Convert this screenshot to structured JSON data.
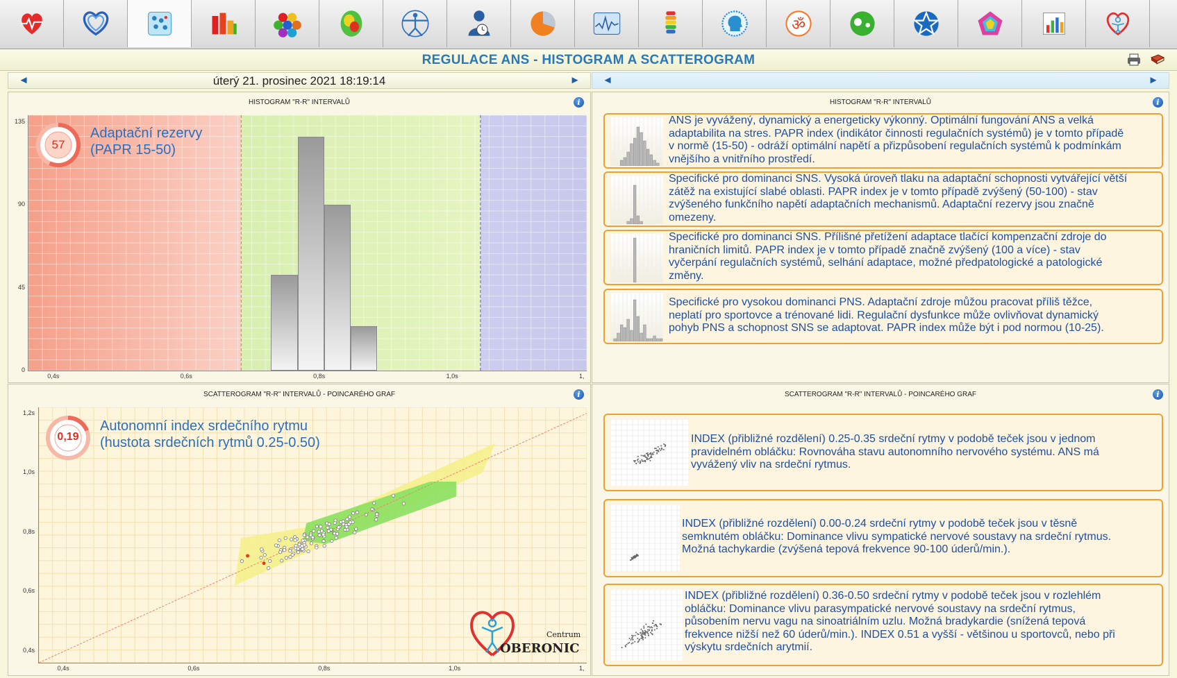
{
  "toolbar": {
    "icons": [
      "heart-pulse-icon",
      "double-heart-icon",
      "dot-grid-icon",
      "bar-chart-icon",
      "hexagon-cluster-icon",
      "brain-map-icon",
      "vitruvian-man-icon",
      "user-clock-icon",
      "pie-chart-icon",
      "waveform-monitor-icon",
      "spine-icon",
      "head-profile-icon",
      "om-symbol-icon",
      "yin-yang-icon",
      "star-icon",
      "radar-pentagon-icon",
      "mini-bar-chart-icon",
      "oberonic-logo-icon"
    ],
    "active_index": 2
  },
  "header": {
    "title": "REGULACE ANS - HISTOGRAM A SCATTEROGRAM"
  },
  "datebar": {
    "date": "úterý 21. prosinec 2021 18:19:14"
  },
  "histogram": {
    "title": "HISTOGRAM \"R-R\" INTERVALŮ",
    "gauge_value": "57",
    "gauge_fraction": 0.57,
    "label_line1": "Adaptační rezervy",
    "label_line2": "(PAPR 15-50)",
    "colors": {
      "zone_low": "#f4a08a",
      "zone_mid": "#d8efb0",
      "zone_high": "#cdcdee",
      "bar": "#c8c8c8"
    }
  },
  "scatter": {
    "title": "SCATTEROGRAM \"R-R\" INTERVALŮ - POINCARÉHO GRAF",
    "gauge_value": "0,19",
    "gauge_fraction": 0.19,
    "label_line1": "Autonomní index srdečního rytmu",
    "label_line2": "(hustota srdečních rytmů 0.25-0.50)",
    "logo_small": "Centrum",
    "logo_big": "OBERONIC"
  },
  "hist_desc": {
    "title": "HISTOGRAM \"R-R\" INTERVALŮ",
    "items": [
      {
        "lines": [
          "ANS je vyvážený, dynamický a energeticky výkonný. Optimální fungování ANS a velká",
          "adaptabilita na stres. PAPR index (indikátor činnosti regulačních systémů) je v tomto případě",
          "v normě (15-50) - odráží optimální napětí a přizpůsobení regulačních systémů k podmínkám",
          "vnějšího a vnitřního prostředí."
        ]
      },
      {
        "lines": [
          "Specifické pro dominanci SNS. Vysoká úroveň tlaku na adaptační schopnosti vytvářející větší",
          "zátěž na existující slabé oblasti. PAPR index je v tomto případě zvýšený (50-100) -  stav",
          "zvýšeného funkčního napětí adaptačních mechanismů. Adaptační rezervy jsou značně",
          "omezeny."
        ]
      },
      {
        "lines": [
          "Specifické pro dominanci SNS. Přílišné přetížení adaptace tlačící kompenzační zdroje do",
          "hraničních limitů. PAPR index je v tomto případě značně zvýšený (100 a více) - stav",
          "vyčerpání regulačních systémů, selhání adaptace, možné předpatologické a patologické",
          "změny."
        ]
      },
      {
        "lines": [
          "Specifické pro vysokou dominanci PNS. Adaptační zdroje můžou pracovat příliš těžce,",
          "neplatí pro sportovce a trénované lidi. Regulační dysfunkce může ovlivňovat dynamický",
          "pohyb PNS a schopnost SNS se adaptovat. PAPR index může být i pod normou (10-25)."
        ]
      }
    ]
  },
  "scatter_desc": {
    "title": "SCATTEROGRAM \"R-R\" INTERVALŮ - POINCARÉHO GRAF",
    "items": [
      {
        "lines": [
          "INDEX (přibližné rozdělení) 0.25-0.35 srdeční rytmy v podobě teček jsou v jednom",
          "pravidelném obláčku: Rovnováha stavu autonomního nervového systému. ANS má",
          "vyvážený vliv na srdeční rytmus."
        ]
      },
      {
        "lines": [
          "INDEX (přibližné rozdělení) 0.00-0.24 srdeční rytmy v podobě teček jsou v těsně",
          "semknutém obláčku: Dominance vlivu sympatické nervové soustavy na srdeční rytmus.",
          "Možná tachykardie (zvýšená tepová frekvence 90-100 úderů/min.)."
        ]
      },
      {
        "lines": [
          "INDEX (přibližné rozdělení) 0.36-0.50 srdeční rytmy v podobě teček jsou v rozlehlém",
          "obláčku: Dominance vlivu parasympatické nervové soustavy na srdeční rytmus,",
          "působením nervu vagu na sinoatriálním uzlu. Možná bradykardie (snížená tepová",
          "frekvence nižší než 60 úderů/min.). INDEX 0.51 a vyšší - většinou u sportovců, nebo při",
          "výskytu srdečních arytmií."
        ]
      }
    ]
  },
  "chart_data": [
    {
      "type": "bar",
      "title": "HISTOGRAM \"R-R\" INTERVALŮ",
      "x_ticks": [
        "0,4s",
        "0,6s",
        "0,8s",
        "1,0s",
        "1,"
      ],
      "y_ticks": [
        "135",
        "90",
        "45",
        "0"
      ],
      "ylim": [
        0,
        135
      ],
      "xlim": [
        0.36,
        1.2
      ],
      "zones": [
        {
          "from": 0.36,
          "to": 0.68
        },
        {
          "from": 0.68,
          "to": 1.04
        },
        {
          "from": 1.04,
          "to": 1.2
        }
      ],
      "bars": [
        {
          "x0": 0.725,
          "x1": 0.765,
          "value": 52
        },
        {
          "x0": 0.765,
          "x1": 0.805,
          "value": 127
        },
        {
          "x0": 0.805,
          "x1": 0.845,
          "value": 90
        },
        {
          "x0": 0.845,
          "x1": 0.885,
          "value": 24
        }
      ]
    },
    {
      "type": "scatter",
      "title": "SCATTEROGRAM \"R-R\" INTERVALŮ - POINCARÉHO GRAF",
      "x_ticks": [
        "0,4s",
        "0,6s",
        "0,8s",
        "1,0s",
        "1,"
      ],
      "y_ticks": [
        "1,2s",
        "1,0s",
        "0,8s",
        "0,6s",
        "0,4s"
      ],
      "xlim": [
        0.36,
        1.2
      ],
      "ylim": [
        0.36,
        1.22
      ],
      "outliers": [
        [
          0.68,
          0.72
        ],
        [
          0.705,
          0.695
        ]
      ],
      "cloud_center": [
        0.8,
        0.8
      ],
      "cloud_spread": [
        0.045,
        0.025
      ]
    }
  ]
}
